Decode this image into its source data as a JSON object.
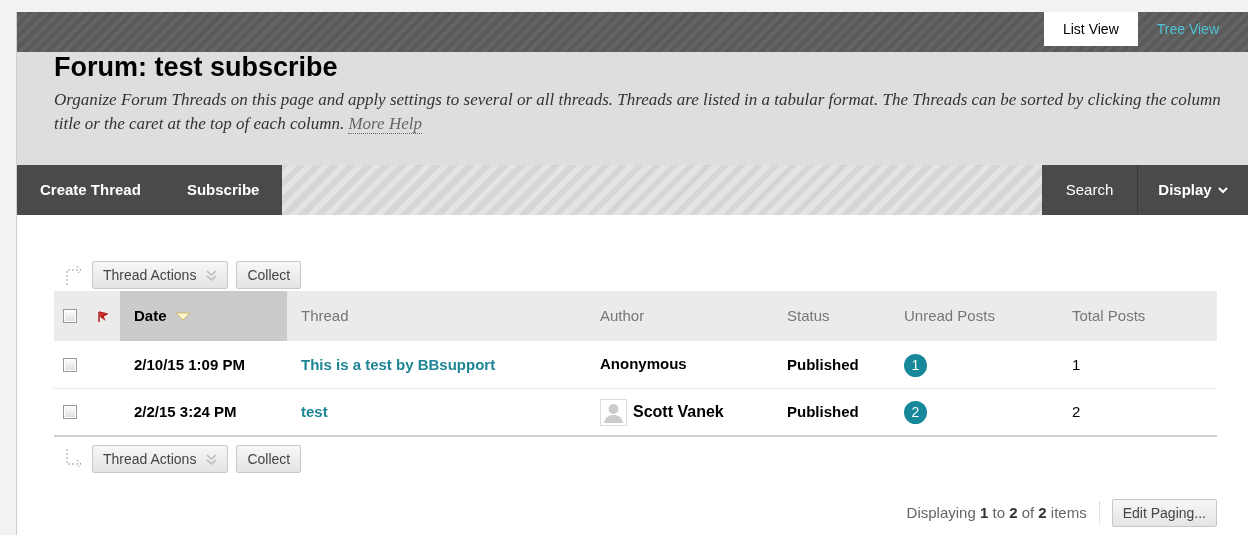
{
  "view_tabs": [
    {
      "label": "List View",
      "selected": true
    },
    {
      "label": "Tree View",
      "selected": false
    }
  ],
  "title": "Forum: test subscribe",
  "description": {
    "text": "Organize Forum Threads on this page and apply settings to several or all threads. Threads are listed in a tabular format. The Threads can be sorted by clicking the column title or the caret at the top of each column.",
    "link": "More Help"
  },
  "action_bar": {
    "left": [
      "Create Thread",
      "Subscribe"
    ],
    "search": "Search",
    "display": "Display"
  },
  "table_actions": [
    {
      "menu": "Thread Actions",
      "button": "Collect"
    },
    {
      "menu": "Thread Actions",
      "button": "Collect"
    }
  ],
  "table": {
    "select_all_checked": false,
    "columns": [
      {
        "label": "Date",
        "sorted": true
      },
      {
        "label": "Thread",
        "sorted": false
      },
      {
        "label": "Author",
        "sorted": false
      },
      {
        "label": "Status",
        "sorted": false
      },
      {
        "label": "Unread Posts",
        "sorted": false
      },
      {
        "label": "Total Posts",
        "sorted": false
      }
    ],
    "rows": [
      {
        "checked": false,
        "date": "2/10/15 1:09 PM",
        "thread": "This is a test by BBsupport",
        "author": "Anonymous",
        "avatar": false,
        "status": "Published",
        "unread": "1",
        "total": "1"
      },
      {
        "checked": false,
        "date": "2/2/15 3:24 PM",
        "thread": "test",
        "author": "Scott Vanek",
        "avatar": true,
        "status": "Published",
        "unread": "2",
        "total": "2"
      }
    ]
  },
  "paging": {
    "text": "Displaying **1** to **2** of **2** items",
    "button": "Edit Paging..."
  }
}
